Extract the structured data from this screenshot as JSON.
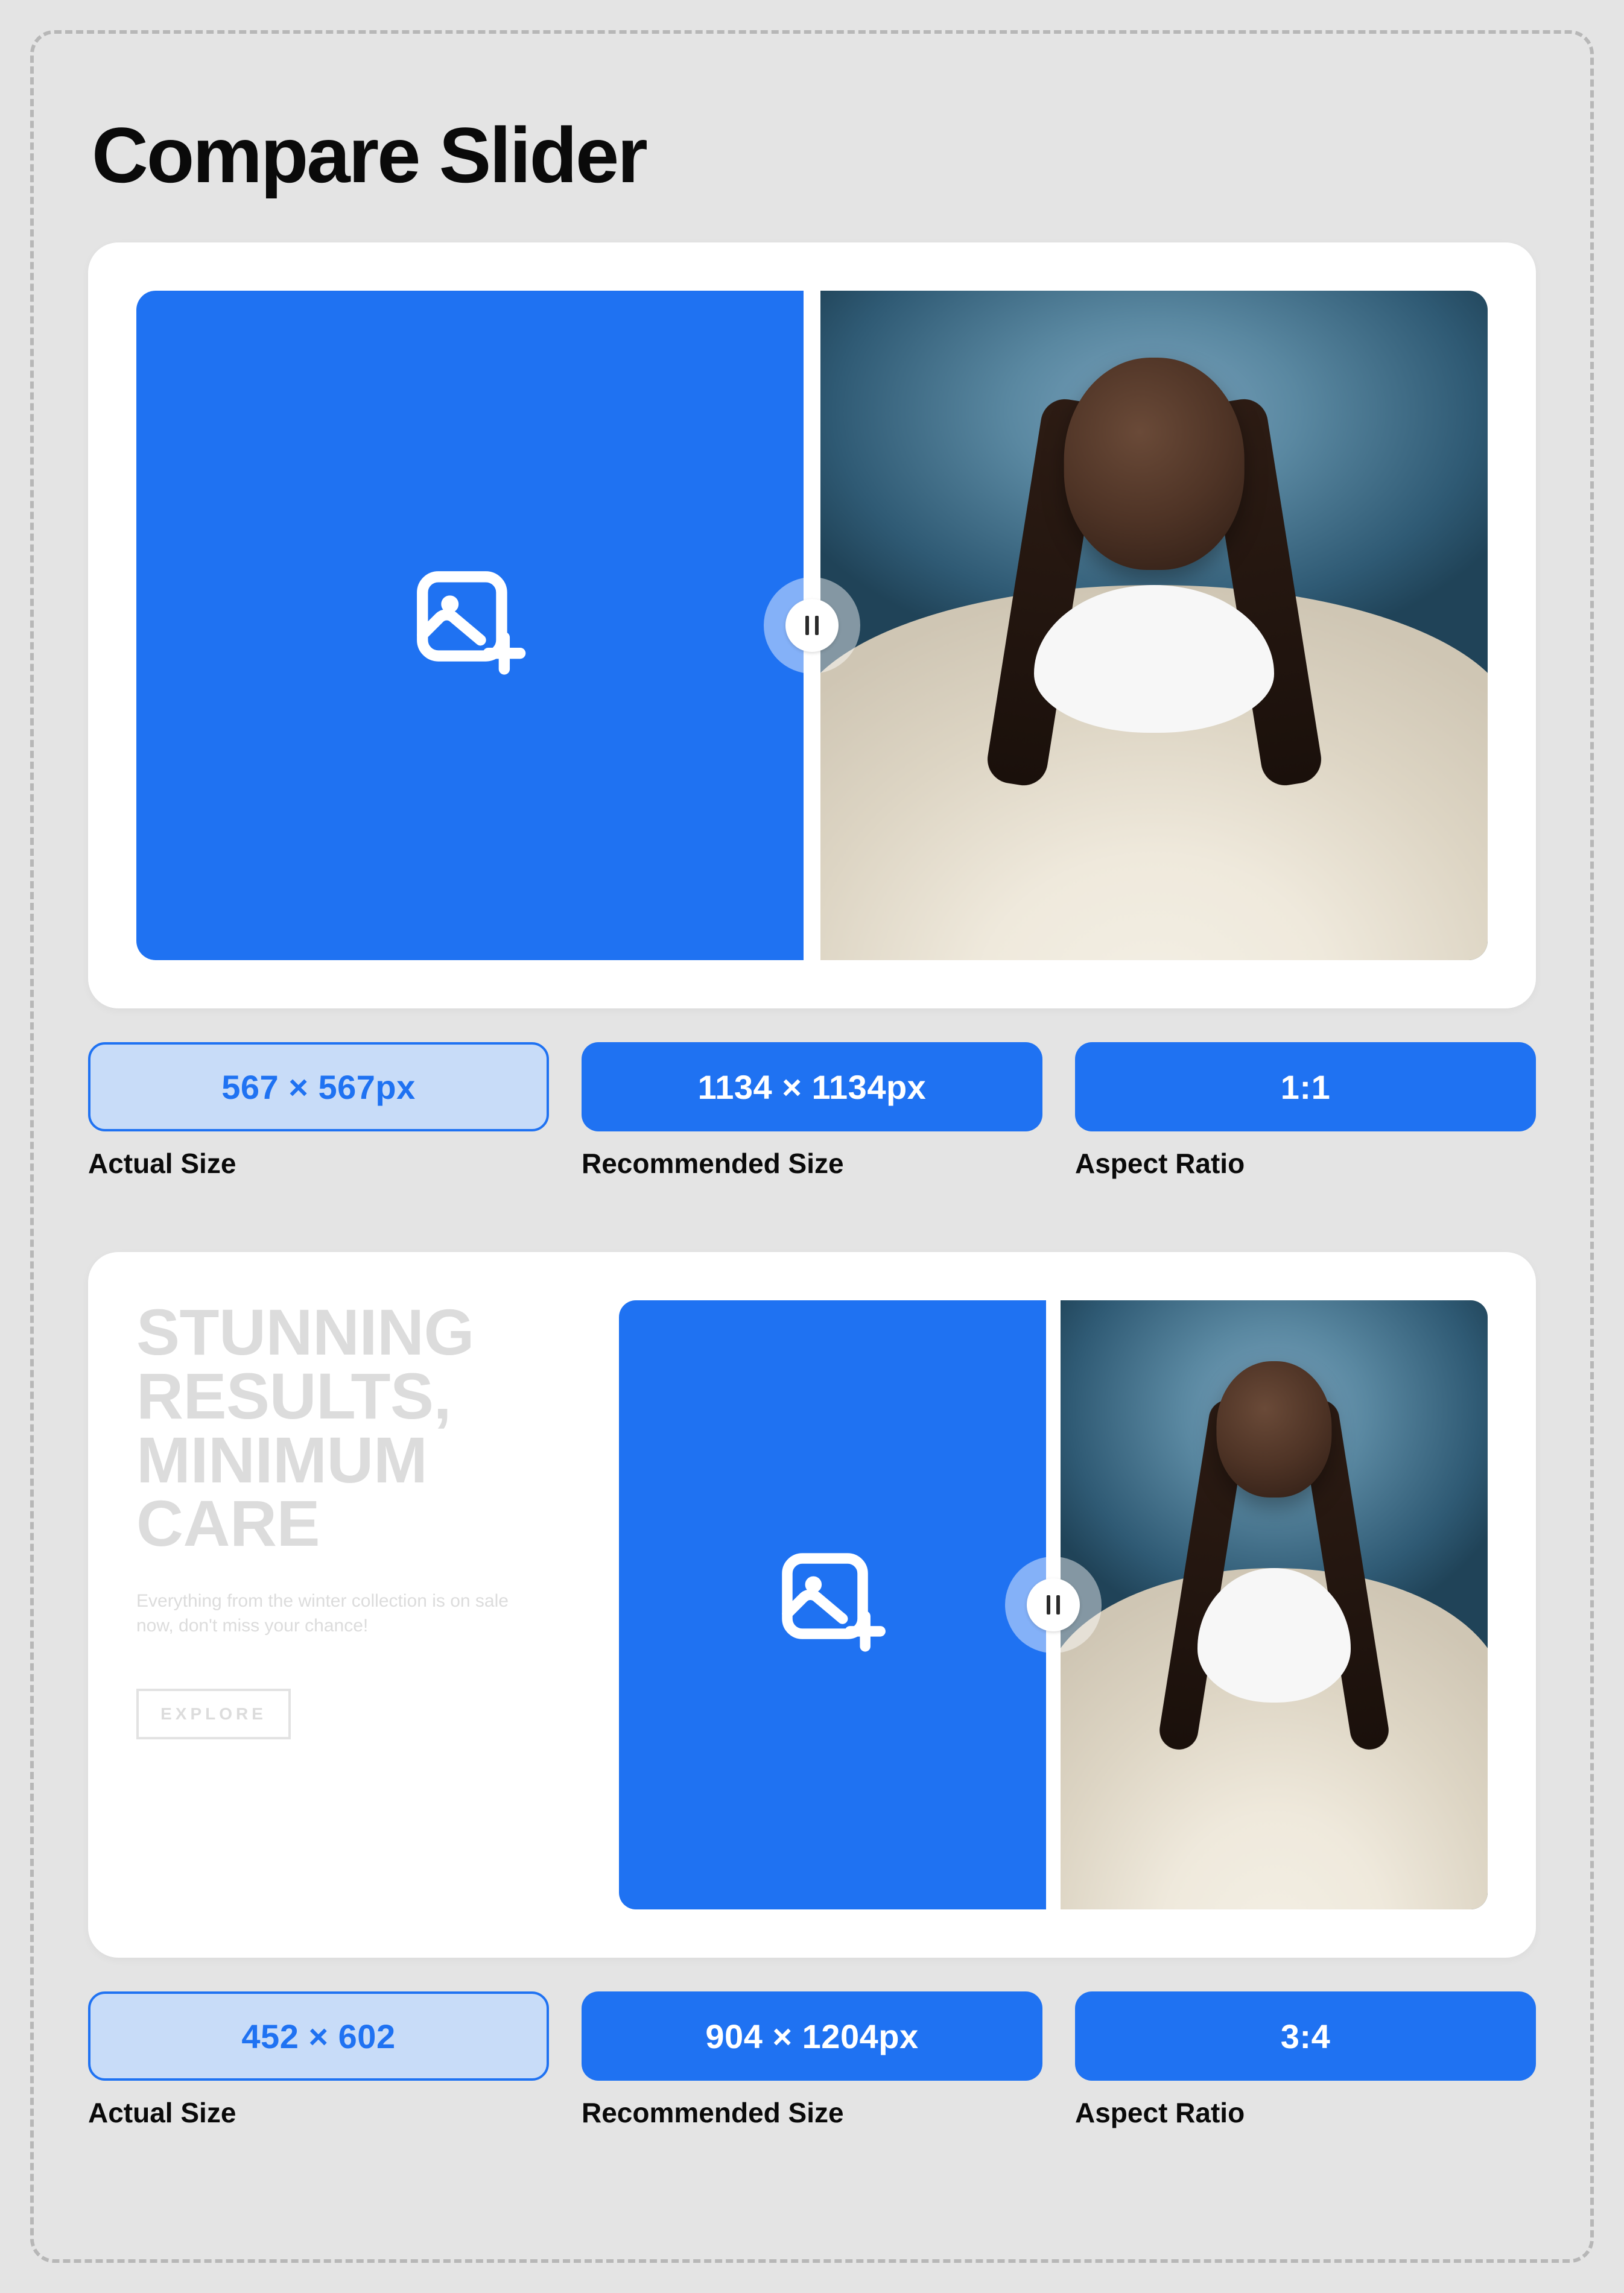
{
  "title": "Compare Slider",
  "labels": {
    "actual": "Actual Size",
    "recommended": "Recommended Size",
    "aspect": "Aspect Ratio"
  },
  "block1": {
    "actual_size": "567 × 567px",
    "recommended_size": "1134 × 1134px",
    "aspect_ratio": "1:1"
  },
  "block2": {
    "promo_title_line1": "STUNNING",
    "promo_title_line2": "RESULTS,",
    "promo_title_line3": "MINIMUM",
    "promo_title_line4": "CARE",
    "promo_sub": "Everything from the winter collection is on sale now, don't miss your chance!",
    "promo_button": "EXPLORE",
    "actual_size": "452 × 602",
    "recommended_size": "904 × 1204px",
    "aspect_ratio": "3:4"
  },
  "colors": {
    "brand": "#1f72f2",
    "brand_tint": "#c8dcf8"
  }
}
